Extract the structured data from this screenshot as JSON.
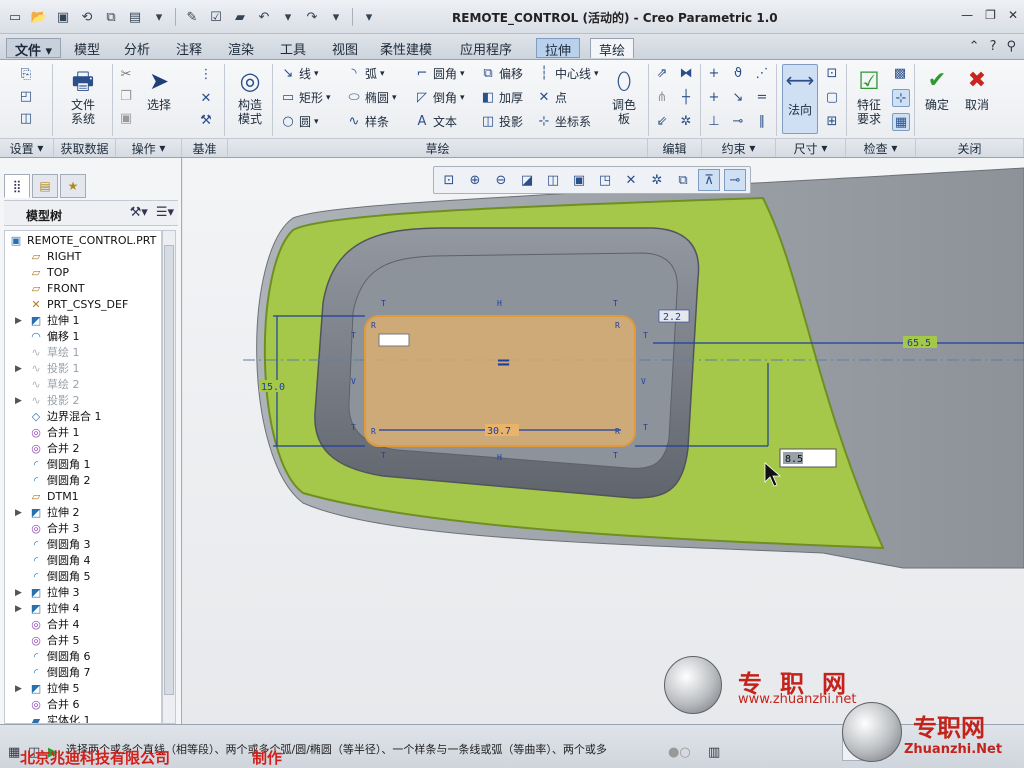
{
  "window": {
    "title": "REMOTE_CONTROL (活动的) - Creo Parametric 1.0"
  },
  "menu": {
    "file": "文件",
    "tabs": [
      "模型",
      "分析",
      "注释",
      "渲染",
      "工具",
      "视图",
      "柔性建模",
      "应用程序",
      "拉伸",
      "草绘"
    ],
    "active_tab": "草绘",
    "highlighted_tab": "拉伸"
  },
  "ribbon": {
    "file_system": "文件\n系统",
    "select": "选择",
    "construct_mode": "构造\n模式",
    "line": "线",
    "arc": "弧",
    "fillet": "圆角",
    "offset": "偏移",
    "centerline": "中心线",
    "rect": "矩形",
    "ellipse": "椭圆",
    "chamfer": "倒角",
    "thicken": "加厚",
    "point": "点",
    "circle": "圆",
    "spline": "样条",
    "text": "文本",
    "project": "投影",
    "csys": "坐标系",
    "palette": "调色\n板",
    "normal": "法向",
    "feature_req": "特征\n要求",
    "ok": "确定",
    "cancel": "取消",
    "groups": {
      "setup": "设置",
      "get_data": "获取数据",
      "operations": "操作",
      "datum": "基准",
      "sketching": "草绘",
      "editing": "编辑",
      "constrain": "约束",
      "dimension": "尺寸",
      "inspect": "检查",
      "close": "关闭"
    }
  },
  "tree": {
    "title": "模型树",
    "root": "REMOTE_CONTROL.PRT",
    "items": [
      {
        "label": "RIGHT",
        "expand": false,
        "dim": false
      },
      {
        "label": "TOP",
        "expand": false,
        "dim": false
      },
      {
        "label": "FRONT",
        "expand": false,
        "dim": false
      },
      {
        "label": "PRT_CSYS_DEF",
        "expand": false,
        "dim": false
      },
      {
        "label": "拉伸 1",
        "expand": true,
        "dim": false
      },
      {
        "label": "偏移 1",
        "expand": false,
        "dim": false
      },
      {
        "label": "草绘 1",
        "expand": false,
        "dim": true
      },
      {
        "label": "投影 1",
        "expand": true,
        "dim": true
      },
      {
        "label": "草绘 2",
        "expand": false,
        "dim": true
      },
      {
        "label": "投影 2",
        "expand": true,
        "dim": true
      },
      {
        "label": "边界混合 1",
        "expand": false,
        "dim": false
      },
      {
        "label": "合并 1",
        "expand": false,
        "dim": false
      },
      {
        "label": "合并 2",
        "expand": false,
        "dim": false
      },
      {
        "label": "倒圆角 1",
        "expand": false,
        "dim": false
      },
      {
        "label": "倒圆角 2",
        "expand": false,
        "dim": false
      },
      {
        "label": "DTM1",
        "expand": false,
        "dim": false
      },
      {
        "label": "拉伸 2",
        "expand": true,
        "dim": false
      },
      {
        "label": "合并 3",
        "expand": false,
        "dim": false
      },
      {
        "label": "倒圆角 3",
        "expand": false,
        "dim": false
      },
      {
        "label": "倒圆角 4",
        "expand": false,
        "dim": false
      },
      {
        "label": "倒圆角 5",
        "expand": false,
        "dim": false
      },
      {
        "label": "拉伸 3",
        "expand": true,
        "dim": false
      },
      {
        "label": "拉伸 4",
        "expand": true,
        "dim": false
      },
      {
        "label": "合并 4",
        "expand": false,
        "dim": false
      },
      {
        "label": "合并 5",
        "expand": false,
        "dim": false
      },
      {
        "label": "倒圆角 6",
        "expand": false,
        "dim": false
      },
      {
        "label": "倒圆角 7",
        "expand": false,
        "dim": false
      },
      {
        "label": "拉伸 5",
        "expand": true,
        "dim": false
      },
      {
        "label": "合并 6",
        "expand": false,
        "dim": false
      },
      {
        "label": "实体化 1",
        "expand": false,
        "dim": false
      }
    ]
  },
  "sketch": {
    "dim_height": "15.0",
    "dim_width": "30.7",
    "dim_radius": "2.2",
    "dim_offset": "65.5",
    "dim_input": "8.5",
    "equal_marker": "="
  },
  "status": {
    "message": "选择两个或多个直线（相等段）、两个或多个弧/圆/椭圆（等半径）、一个样条与一条线或弧（等曲率）、两个或多",
    "company": "北京兆迪科技有限公司",
    "made": "制作"
  },
  "watermark": {
    "brand1": "专职网",
    "url1": "www.zhuanzhi.net",
    "brand2": "专职网",
    "url2": "Zhuanzhi.Net"
  },
  "colors": {
    "surface_green": "#a5c84a",
    "part_gray": "#8e949b",
    "sketch_orange": "#e09a3a",
    "dim_blue": "#1d3fa0",
    "accent_red": "#d1201a"
  }
}
